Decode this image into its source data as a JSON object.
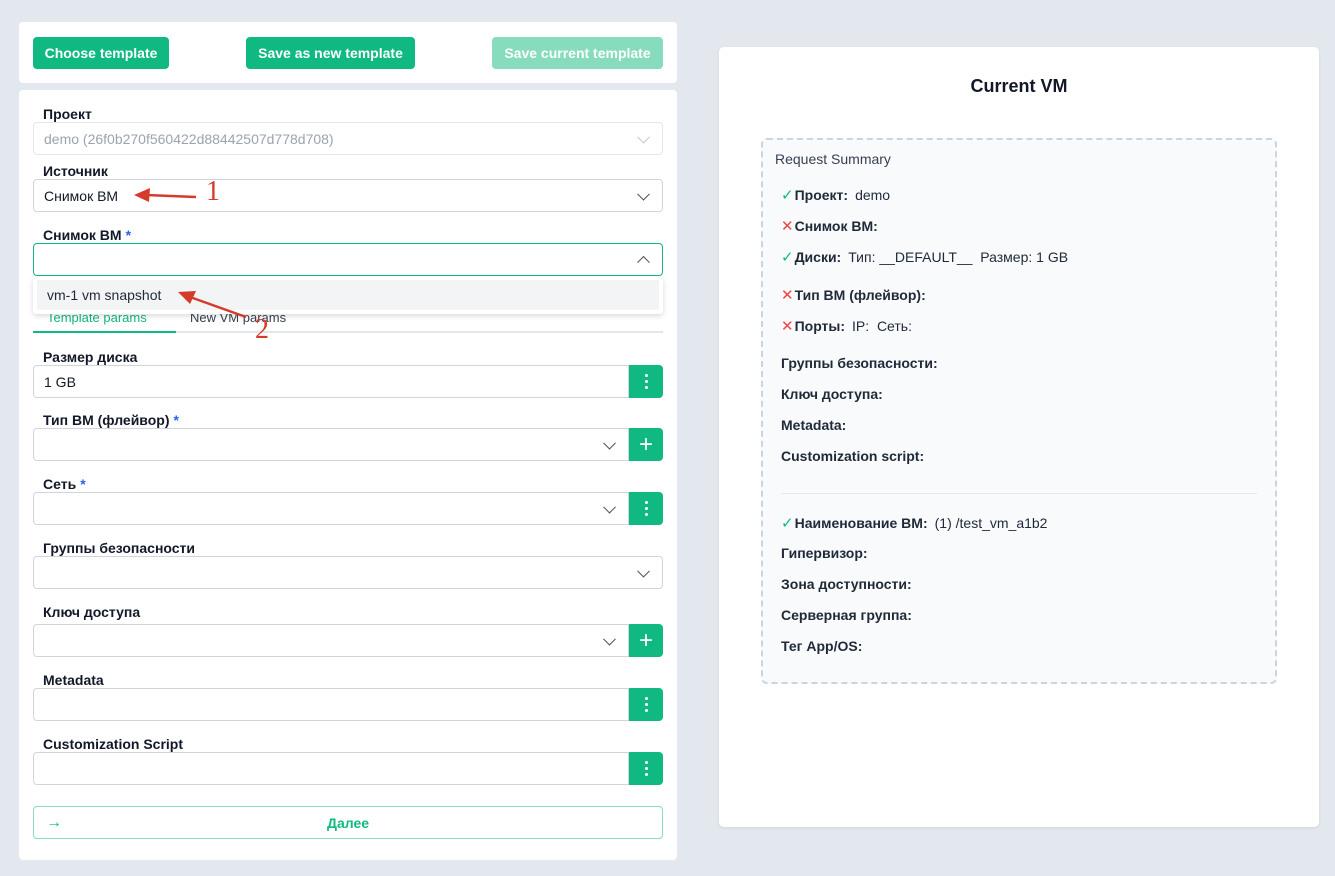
{
  "toolbar": {
    "choose_template": "Choose template",
    "save_new_template": "Save as new template",
    "save_current_template": "Save current template"
  },
  "form": {
    "project": {
      "label": "Проект",
      "value": "demo (26f0b270f560422d88442507d778d708)"
    },
    "source": {
      "label": "Источник",
      "value": "Снимок ВМ"
    },
    "snapshot": {
      "label": "Снимок ВМ",
      "required_mark": "*",
      "value": ""
    },
    "snapshot_options": [
      "vm-1 vm snapshot"
    ],
    "tabs": [
      {
        "label": "Template params"
      },
      {
        "label": "New VM params"
      }
    ],
    "disk_size": {
      "label": "Размер диска",
      "value": "1 GB"
    },
    "flavor": {
      "label": "Тип ВМ (флейвор)",
      "required_mark": "*",
      "value": ""
    },
    "network": {
      "label": "Сеть",
      "required_mark": "*",
      "value": ""
    },
    "security_groups": {
      "label": "Группы безопасности",
      "value": ""
    },
    "access_key": {
      "label": "Ключ доступа",
      "value": ""
    },
    "metadata": {
      "label": "Metadata",
      "value": ""
    },
    "customization_script": {
      "label": "Customization Script",
      "value": ""
    },
    "next_button": "Далее"
  },
  "vm_panel": {
    "title": "Current VM",
    "summary_title": "Request Summary",
    "rows": {
      "project": {
        "label": "Проект:",
        "value": "demo",
        "status": "ok"
      },
      "snapshot": {
        "label": "Снимок ВМ:",
        "status": "error"
      },
      "disks": {
        "label": "Диски:",
        "value": "Тип: __DEFAULT__  Размер: 1 GB",
        "status": "ok"
      },
      "flavor": {
        "label": "Тип ВМ (флейвор):",
        "status": "error"
      },
      "ports": {
        "label": "Порты:",
        "value": "IP:  Сеть:",
        "status": "error"
      },
      "security_groups": {
        "label": "Группы безопасности:"
      },
      "access_key": {
        "label": "Ключ доступа:"
      },
      "metadata": {
        "label": "Metadata:"
      },
      "customization_script": {
        "label": "Customization script:"
      },
      "vm_name": {
        "label": "Наименование ВМ:",
        "value": "(1) /test_vm_a1b2",
        "status": "ok"
      },
      "hypervisor": {
        "label": "Гипервизор:"
      },
      "availability_zone": {
        "label": "Зона доступности:"
      },
      "server_group": {
        "label": "Серверная группа:"
      },
      "app_os_tag": {
        "label": "Тег App/OS:"
      }
    }
  },
  "annotations": {
    "marker_1": "1",
    "marker_2": "2",
    "color": "#d63a2b"
  },
  "colors": {
    "accent": "#10b981",
    "error": "#ef4444",
    "required": "#2563eb"
  }
}
